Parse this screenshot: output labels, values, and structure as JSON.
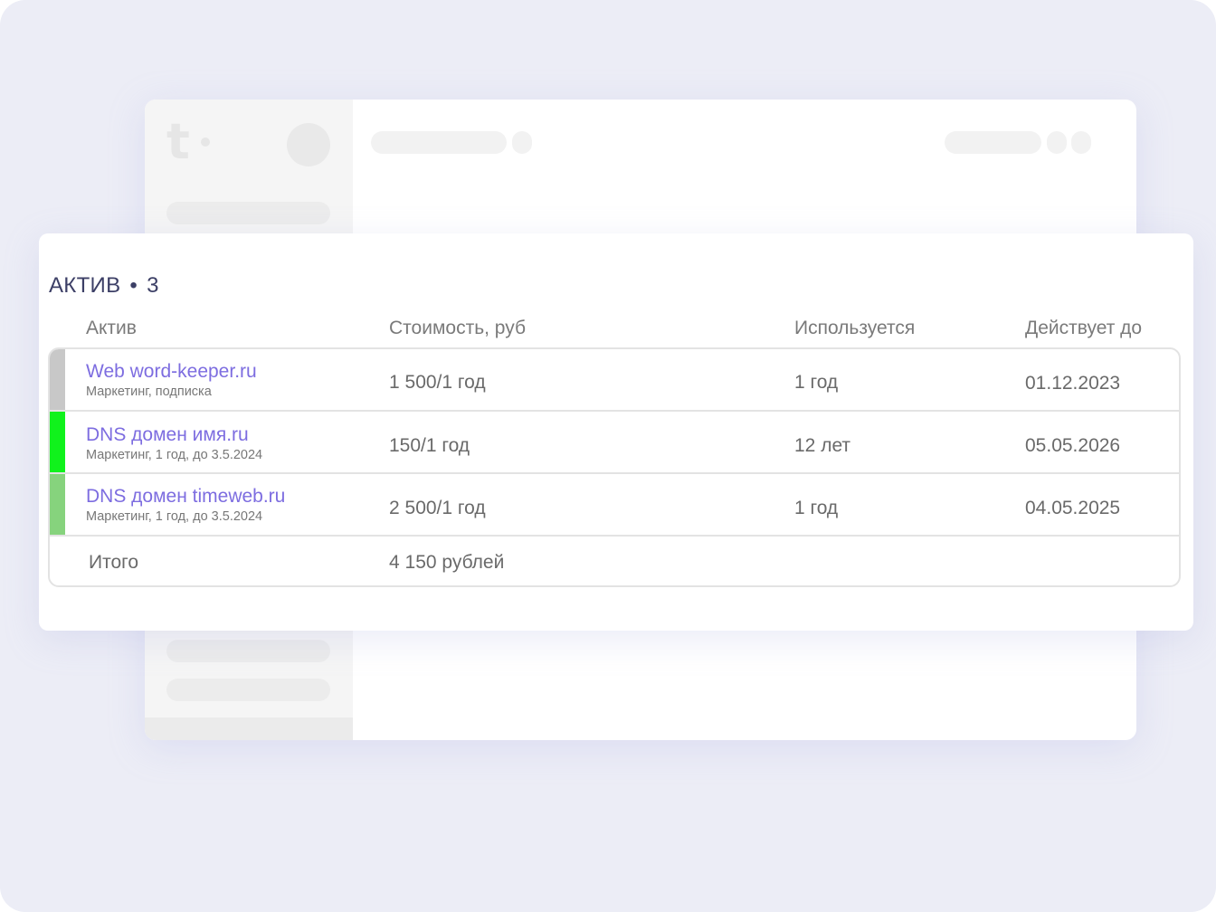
{
  "card": {
    "title": "АКТИВ",
    "separator": "•",
    "count": "3"
  },
  "columns": {
    "asset": "Актив",
    "cost": "Стоимость, руб",
    "used": "Используется",
    "valid_until": "Действует до"
  },
  "rows": [
    {
      "name": "Web word-keeper.ru",
      "subtitle": "Маркетинг, подписка",
      "cost": "1 500/1 год",
      "used": "1 год",
      "valid_until": "01.12.2023",
      "status_color": "#c8c8c8"
    },
    {
      "name": "DNS домен имя.ru",
      "subtitle": "Маркетинг, 1 год, до 3.5.2024",
      "cost": "150/1 год",
      "used": "12 лет",
      "valid_until": "05.05.2026",
      "status_color": "#10f21c"
    },
    {
      "name": "DNS домен timeweb.ru",
      "subtitle": "Маркетинг, 1 год, до 3.5.2024",
      "cost": "2 500/1 год",
      "used": "1 год",
      "valid_until": "04.05.2025",
      "status_color": "#86d37d"
    }
  ],
  "total": {
    "label": "Итого",
    "value": "4 150 рублей"
  },
  "colors": {
    "accent_link": "#7d6de0",
    "title": "#3c3f66",
    "background": "#ecedf6"
  }
}
